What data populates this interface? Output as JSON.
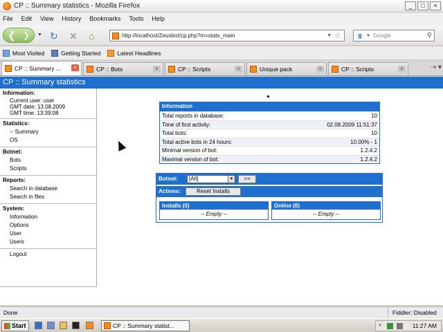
{
  "window": {
    "title": "CP :: Summary statistics - Mozilla Firefox",
    "buttons": {
      "minimize": "_",
      "maximize": "□",
      "close": "×"
    }
  },
  "menu": [
    "File",
    "Edit",
    "View",
    "History",
    "Bookmarks",
    "Tools",
    "Help"
  ],
  "nav": {
    "url": "http://localhost/Zeusbot/cp.php?m=stats_main",
    "search_placeholder": "Google"
  },
  "bookmarks": [
    {
      "label": "Most Visited",
      "icon": "most-visited-icon"
    },
    {
      "label": "Getting Started",
      "icon": "bookmark-icon"
    },
    {
      "label": "Latest Headlines",
      "icon": "rss-feed-icon"
    }
  ],
  "tabs": [
    {
      "label": "CP :: Summary ...",
      "active": true
    },
    {
      "label": "CP :: Bots",
      "active": false
    },
    {
      "label": "CP :: Scripts",
      "active": false
    },
    {
      "label": "Unique pack",
      "active": false
    },
    {
      "label": "CP :: Scripts",
      "active": false
    }
  ],
  "page": {
    "header": "CP :: Summary statistics",
    "sidebar": {
      "information": {
        "title": "Information:",
        "lines": [
          "Current user: user",
          "GMT date: 13.08.2009",
          "GMT time: 13:39:08"
        ]
      },
      "statistics": {
        "title": "Statistics:",
        "items": [
          "-- Summary",
          "OS"
        ]
      },
      "botnet": {
        "title": "Botnet:",
        "items": [
          "Bots",
          "Scripts"
        ]
      },
      "reports": {
        "title": "Reports:",
        "items": [
          "Search in database",
          "Search in files"
        ]
      },
      "system": {
        "title": "System:",
        "items": [
          "Information",
          "Options",
          "User",
          "Users"
        ]
      },
      "logout": "Logout"
    },
    "info_table": {
      "title": "Information",
      "rows": [
        {
          "label": "Total reports in database:",
          "value": "10"
        },
        {
          "label": "Time of first activity:",
          "value": "02.08.2009 11:51:37"
        },
        {
          "label": "Total bots:",
          "value": "10"
        },
        {
          "label": "Total active bots in 24 hours:",
          "value": "10.00% - 1"
        },
        {
          "label": "Minimal version of bot:",
          "value": "1.2.4.2"
        },
        {
          "label": "Maximal version of bot:",
          "value": "1.2.4.2"
        }
      ]
    },
    "botnet_panel": {
      "botnet_label": "Botnet:",
      "botnet_value": "[All]",
      "go_label": ">>",
      "actions_label": "Actions:",
      "reset_label": "Reset Installs",
      "installs_title": "Installs (0)",
      "online_title": "Online (0)",
      "empty_text": "-- Empty --"
    }
  },
  "status": {
    "left": "Done",
    "right": "Fiddler: Disabled"
  },
  "taskbar": {
    "start": "Start",
    "task": "CP :: Summary statist...",
    "clock": "11:27 AM"
  }
}
